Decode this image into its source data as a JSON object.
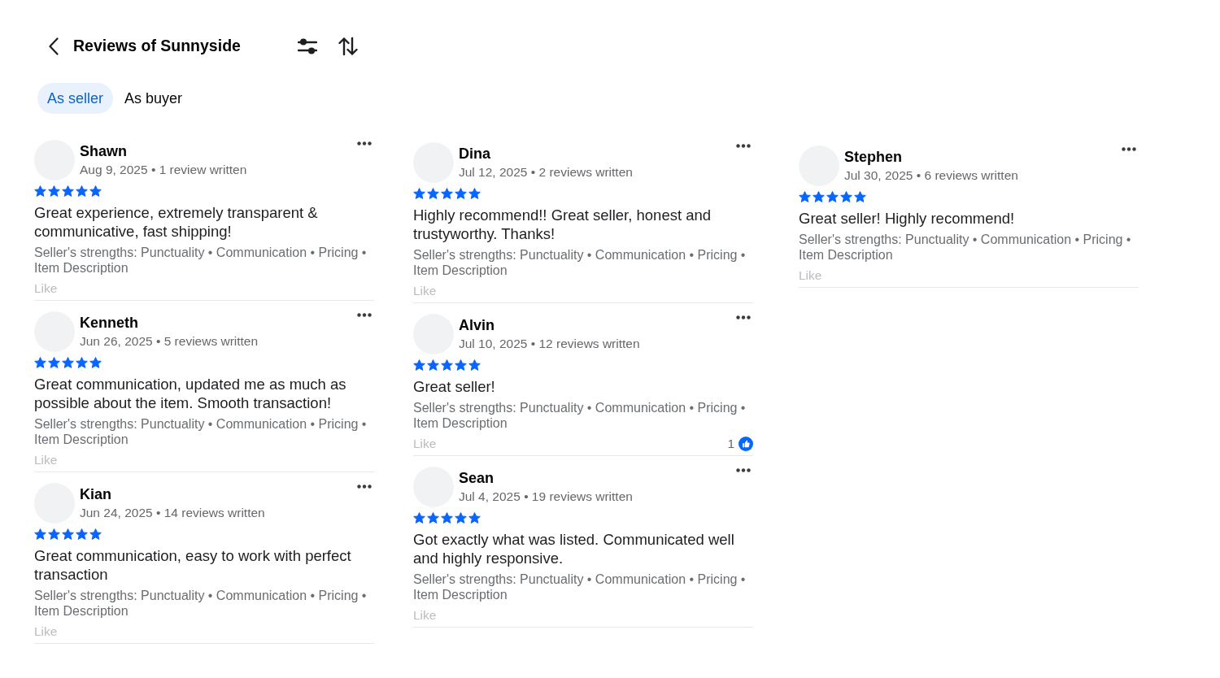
{
  "header": {
    "title": "Reviews of Sunnyside"
  },
  "tabs": [
    {
      "label": "As seller",
      "selected": true
    },
    {
      "label": "As buyer",
      "selected": false
    }
  ],
  "columns": [
    {
      "reviews": [
        {
          "name": "Shawn",
          "meta": "Aug 9, 2025 • 1 review written",
          "stars": 5,
          "text": "Great experience, extremely transparent & communicative, fast shipping!",
          "strengths": "Seller's strengths: Punctuality • Communication • Pricing • Item Description",
          "like_label": "Like"
        },
        {
          "name": "Kenneth",
          "meta": "Jun 26, 2025 • 5 reviews written",
          "stars": 5,
          "text": "Great communication, updated me as much as possible about the item. Smooth transaction!",
          "strengths": "Seller's strengths: Punctuality • Communication • Pricing • Item Description",
          "like_label": "Like"
        },
        {
          "name": "Kian",
          "meta": "Jun 24, 2025 • 14 reviews written",
          "stars": 5,
          "text": "Great communication, easy to work with perfect transaction",
          "strengths": "Seller's strengths: Punctuality • Communication • Pricing • Item Description",
          "like_label": "Like"
        }
      ]
    },
    {
      "reviews": [
        {
          "name": "Dina",
          "meta": "Jul 12, 2025 • 2 reviews written",
          "stars": 5,
          "text": "Highly recommend!! Great seller, honest and trustyworthy. Thanks!",
          "strengths": "Seller's strengths: Punctuality • Communication • Pricing • Item Description",
          "like_label": "Like"
        },
        {
          "name": "Alvin",
          "meta": "Jul 10, 2025 • 12 reviews written",
          "stars": 5,
          "text": "Great seller!",
          "strengths": "Seller's strengths: Punctuality • Communication • Pricing • Item Description",
          "like_label": "Like",
          "like_count": "1"
        },
        {
          "name": "Sean",
          "meta": "Jul 4, 2025 • 19 reviews written",
          "stars": 5,
          "text": "Got exactly what was listed. Communicated well and highly responsive.",
          "strengths": "Seller's strengths: Punctuality • Communication • Pricing • Item Description",
          "like_label": "Like"
        }
      ]
    },
    {
      "reviews": [
        {
          "name": "Stephen",
          "meta": "Jul 30, 2025 • 6 reviews written",
          "stars": 5,
          "text": "Great seller! Highly recommend!",
          "strengths": "Seller's strengths: Punctuality • Communication • Pricing • Item Description",
          "like_label": "Like"
        }
      ]
    }
  ]
}
